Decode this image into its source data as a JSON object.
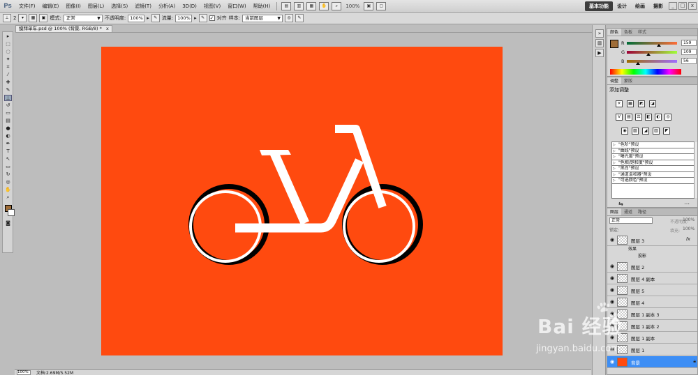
{
  "app": {
    "logo": "Ps",
    "menus": [
      "文件(F)",
      "编辑(E)",
      "图像(I)",
      "图层(L)",
      "选择(S)",
      "滤镜(T)",
      "分析(A)",
      "3D(D)",
      "视图(V)",
      "窗口(W)",
      "帮助(H)"
    ],
    "zoom": "100%",
    "workspaces": [
      "基本功能",
      "设计",
      "绘画",
      "摄影"
    ],
    "active_workspace": "基本功能",
    "window_controls": [
      "_",
      "□",
      "x"
    ]
  },
  "options": {
    "brush_size": "2",
    "mode_label": "模式:",
    "mode_value": "正常",
    "opacity_label": "不透明度:",
    "opacity_value": "100%",
    "flow_label": "流量:",
    "flow_value": "100%",
    "align_label": "对齐",
    "align_checked": true,
    "sample_label": "样本:",
    "sample_value": "当前图层"
  },
  "document": {
    "tab_title": "摸拜单车.psd @ 100% (背景, RGB/8) *",
    "close_glyph": "x",
    "status_zoom": "100%",
    "status_info": "文档:2.69M/5.52M",
    "canvas_color": "#ff4a0f",
    "bike_color": "#ffffff",
    "tire_color": "#000000"
  },
  "color_panel": {
    "tabs": [
      "颜色",
      "色板",
      "样式"
    ],
    "r": 159,
    "g": 109,
    "b": 56,
    "r_label": "R",
    "g_label": "G",
    "b_label": "B",
    "chip_color": "#9f6d38"
  },
  "adjustments_panel": {
    "tabs": [
      "调整",
      "蒙版"
    ],
    "title": "添加调整",
    "icons_row1": [
      "☀",
      "▦",
      "◩",
      "◪"
    ],
    "icons_row2": [
      "V",
      "▤",
      "⚖",
      "◧",
      "◐",
      "◎"
    ],
    "icons_row3": [
      "◉",
      "▨",
      "◢",
      "▥",
      "◤"
    ],
    "presets": [
      "\"色阶\"预设",
      "\"曲线\"预设",
      "\"曝光度\"预设",
      "\"色相/饱和度\"预设",
      "\"黑白\"预设",
      "\"通道混和器\"预设",
      "\"可选颜色\"预设"
    ]
  },
  "layers_panel": {
    "tabs": [
      "图层",
      "通道",
      "路径"
    ],
    "blend_mode": "正常",
    "opacity_label": "不透明度:",
    "opacity_value": "100%",
    "lock_label": "锁定:",
    "fill_label": "填充:",
    "fill_value": "100%",
    "effects_label": "效果",
    "effect_item": "投影",
    "fx": "fx",
    "layers": [
      {
        "name": "图层 3",
        "fx": true
      },
      {
        "name": "图层 2"
      },
      {
        "name": "图层 4 副本"
      },
      {
        "name": "图层 5"
      },
      {
        "name": "图层 4"
      },
      {
        "name": "图层 1 副本 3"
      },
      {
        "name": "图层 1 副本 2"
      },
      {
        "name": "图层 1 副本"
      },
      {
        "name": "图层 1"
      },
      {
        "name": "背景",
        "selected": true,
        "locked": true
      }
    ]
  },
  "watermark": {
    "text": "Bai 经验",
    "url": "jingyan.baidu.com"
  }
}
